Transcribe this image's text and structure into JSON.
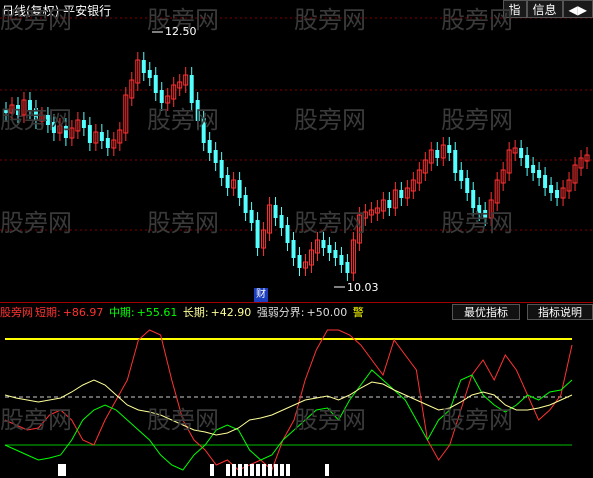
{
  "header": {
    "title": "日线(复权)  平安银行"
  },
  "buttons": {
    "zhi": "指",
    "info": "信息",
    "arrow": "◀▶"
  },
  "watermark": "股旁网",
  "price_labels": {
    "high": "12.50",
    "low": "10.03"
  },
  "cai_badge": "财",
  "indicator": {
    "short_label": "短期:",
    "short_value": "+86.97",
    "mid_label": "中期:",
    "mid_value": "+55.61",
    "long_label": "长期:",
    "long_value": "+42.90",
    "split_label": "强弱分界:",
    "split_value": "+50.00",
    "alert": "警",
    "partial_name": "股旁网"
  },
  "panel_buttons": {
    "best": "最优指标",
    "explain": "指标说明"
  },
  "colors": {
    "up": "#ff3232",
    "down": "#54ffff",
    "short": "#ff3232",
    "mid": "#00ff00",
    "long": "#ffff99",
    "yellow_line": "#ffff00",
    "green_line": "#00c000",
    "grid": "#800000"
  },
  "chart_data": {
    "type": "candlestick",
    "price_high": 12.5,
    "price_low": 10.03,
    "indicator_levels": {
      "short": 86.97,
      "mid": 55.61,
      "long": 42.9,
      "split": 50.0
    }
  }
}
